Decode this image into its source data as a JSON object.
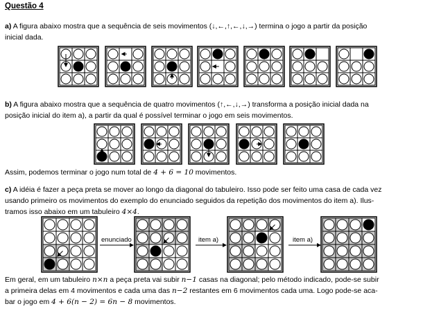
{
  "title": "Questão 4",
  "a": {
    "label": "a)",
    "text1": "A figura abaixo mostra que a sequência de seis movimentos",
    "seq": "(↓,←,↑,←,↓,→)",
    "text2": "termina o jogo a partir da posição",
    "text3": "inicial dada."
  },
  "b": {
    "label": "b)",
    "text1": "A figura abaixo mostra que a sequência de quatro movimentos",
    "seq": "(↑,←,↓,→)",
    "text2": "transforma a posição inicial dada na",
    "text3": "posição inicial do item a), a partir da qual é possível terminar o jogo em seis movimentos.",
    "conclusion_pre": "Assim, podemos terminar o jogo num total de",
    "conclusion_math": "4 + 6 = 10",
    "conclusion_post": "movimentos."
  },
  "c": {
    "label": "c)",
    "line1": "A idéia é fazer a peça preta se mover ao longo da diagonal do tabuleiro. Isso pode ser feito uma casa de cada vez",
    "line2": "usando primeiro os movimentos do exemplo do enunciado seguidos da repetição dos movimentos do item a). Ilus-",
    "line3_pre": "tramos isso abaixo em um tabuleiro",
    "line3_math": "4×4",
    "line3_post": ".",
    "arrow1": "enunciado",
    "arrow2": "item a)",
    "arrow3": "item a)"
  },
  "final": {
    "l1_a": "Em geral, em um tabuleiro",
    "l1_m1": "n×n",
    "l1_b": "a peça preta vai subir",
    "l1_m2": "n−1",
    "l1_c": "casas na diagonal; pelo método indicado, pode-se subir",
    "l2_a": "a primeira delas em 4 movimentos e cada uma das",
    "l2_m": "n−2",
    "l2_b": "restantes em 6 movimentos cada uma. Logo pode-se aca-",
    "l3_a": "bar o jogo em",
    "l3_m": "4 + 6(n − 2) = 6n − 8",
    "l3_b": "movimentos."
  }
}
